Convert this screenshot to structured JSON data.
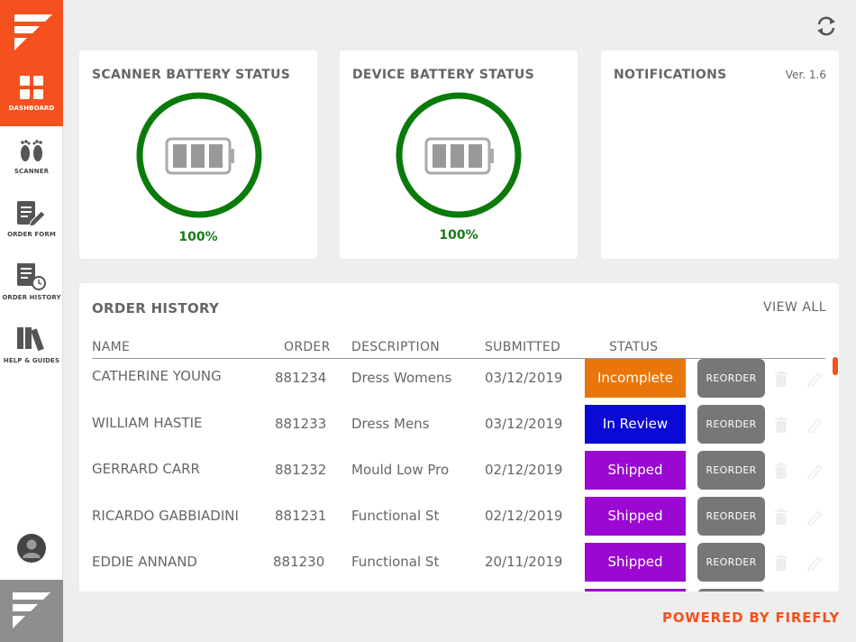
{
  "sidebar": {
    "items": [
      {
        "label": "DASHBOARD",
        "icon": "dashboard-grid-icon",
        "active": true
      },
      {
        "label": "SCANNER",
        "icon": "footprints-icon",
        "active": false
      },
      {
        "label": "ORDER FORM",
        "icon": "document-edit-icon",
        "active": false
      },
      {
        "label": "ORDER HISTORY",
        "icon": "document-clock-icon",
        "active": false
      },
      {
        "label": "HELP & GUIDES",
        "icon": "books-icon",
        "active": false
      }
    ],
    "avatar_icon": "user-avatar-icon",
    "logo_icon": "firefly-logo-icon"
  },
  "header": {
    "refresh_icon": "refresh-icon"
  },
  "scanner_battery": {
    "title": "SCANNER BATTERY STATUS",
    "percent": "100%",
    "level": 1.0
  },
  "device_battery": {
    "title": "DEVICE BATTERY STATUS",
    "percent": "100%",
    "level": 1.0
  },
  "notifications": {
    "title": "NOTIFICATIONS",
    "version": "Ver. 1.6"
  },
  "order_history": {
    "title": "ORDER HISTORY",
    "view_all": "VIEW ALL",
    "columns": {
      "name": "NAME",
      "order": "ORDER",
      "description": "DESCRIPTION",
      "submitted": "SUBMITTED",
      "status": "STATUS"
    },
    "rows": [
      {
        "name": "CATHERINE YOUNG",
        "order": "881234",
        "description": "Dress Womens",
        "submitted": "03/12/2019",
        "status": "Incomplete",
        "status_color": "#e8760a",
        "action": "REORDER"
      },
      {
        "name": "WILLIAM HASTIE",
        "order": "881233",
        "description": "Dress Mens",
        "submitted": "03/12/2019",
        "status": "In Review",
        "status_color": "#0b09d6",
        "action": "REORDER"
      },
      {
        "name": "GERRARD CARR",
        "order": "881232",
        "description": "Mould Low Pro",
        "submitted": "02/12/2019",
        "status": "Shipped",
        "status_color": "#9a08d2",
        "action": "REORDER"
      },
      {
        "name": "RICARDO GABBIADINI",
        "order": "881231",
        "description": "Functional St",
        "submitted": "02/12/2019",
        "status": "Shipped",
        "status_color": "#9a08d2",
        "action": "REORDER"
      },
      {
        "name": "EDDIE ANNAND",
        "order": "881230",
        "description": "Functional St",
        "submitted": "20/11/2019",
        "status": "Shipped",
        "status_color": "#9a08d2",
        "action": "REORDER"
      }
    ]
  },
  "footer": {
    "powered_by": "POWERED BY FIREFLY"
  },
  "colors": {
    "brand": "#f4511e",
    "battery_green": "#1a7a1a",
    "reorder_gray": "#777777"
  }
}
